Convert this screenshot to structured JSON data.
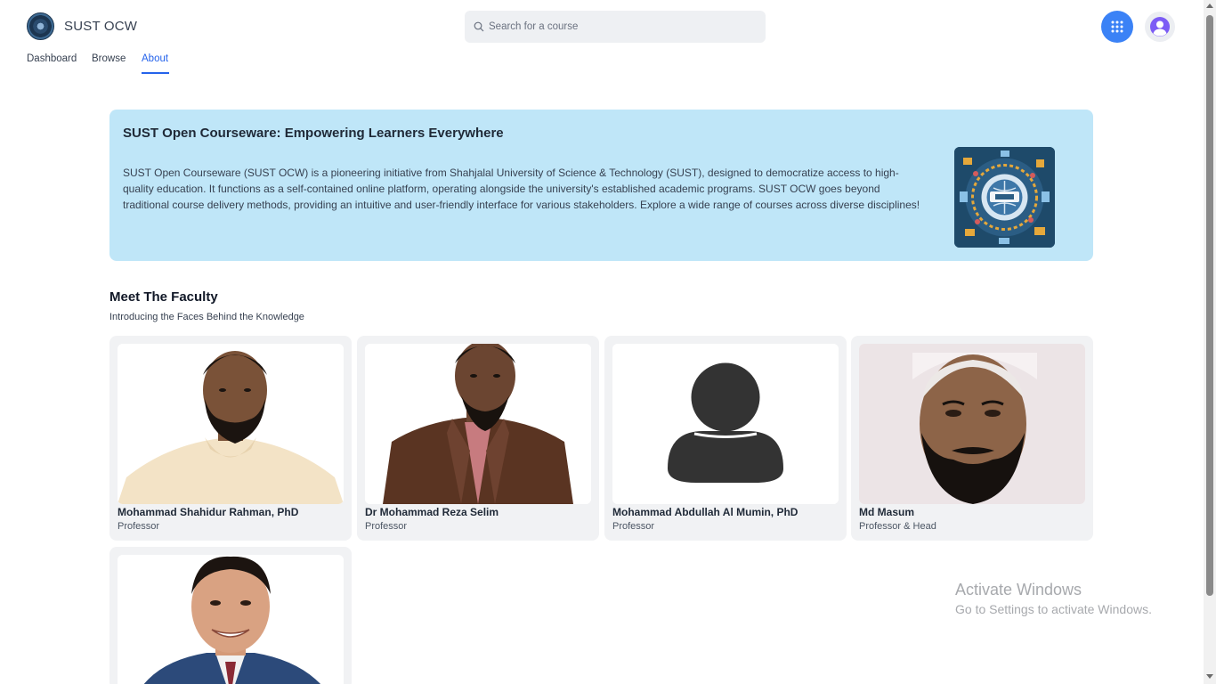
{
  "app": {
    "title": "SUST OCW"
  },
  "search": {
    "placeholder": "Search for a course"
  },
  "nav": {
    "items": [
      "Dashboard",
      "Browse",
      "About"
    ],
    "active": "About"
  },
  "hero": {
    "title": "SUST Open Courseware: Empowering Learners Everywhere",
    "text": "SUST Open Courseware (SUST OCW) is a pioneering initiative from Shahjalal University of Science & Technology (SUST), designed to democratize access to high-quality education. It functions as a self-contained online platform, operating alongside the university's established academic programs. SUST OCW goes beyond traditional course delivery methods, providing an intuitive and user-friendly interface for various stakeholders. Explore a wide range of courses across diverse disciplines!"
  },
  "faculty": {
    "title": "Meet The Faculty",
    "subtitle": "Introducing the Faces Behind the Knowledge",
    "members": [
      {
        "name": "Mohammad Shahidur Rahman, PhD",
        "role": "Professor"
      },
      {
        "name": "Dr Mohammad Reza Selim",
        "role": "Professor"
      },
      {
        "name": "Mohammad Abdullah Al Mumin, PhD",
        "role": "Professor"
      },
      {
        "name": "Md Masum",
        "role": "Professor & Head"
      },
      {
        "name": "",
        "role": ""
      }
    ]
  },
  "watermark": {
    "title": "Activate Windows",
    "subtitle": "Go to Settings to activate Windows."
  },
  "colors": {
    "accent": "#2563eb",
    "hero_bg": "#bfe6f8",
    "card_bg": "#f1f2f4",
    "apps_button": "#3b82f6"
  },
  "icons": [
    "logo-icon",
    "search-icon",
    "apps-grid-icon",
    "user-avatar-icon",
    "default-person-icon"
  ]
}
